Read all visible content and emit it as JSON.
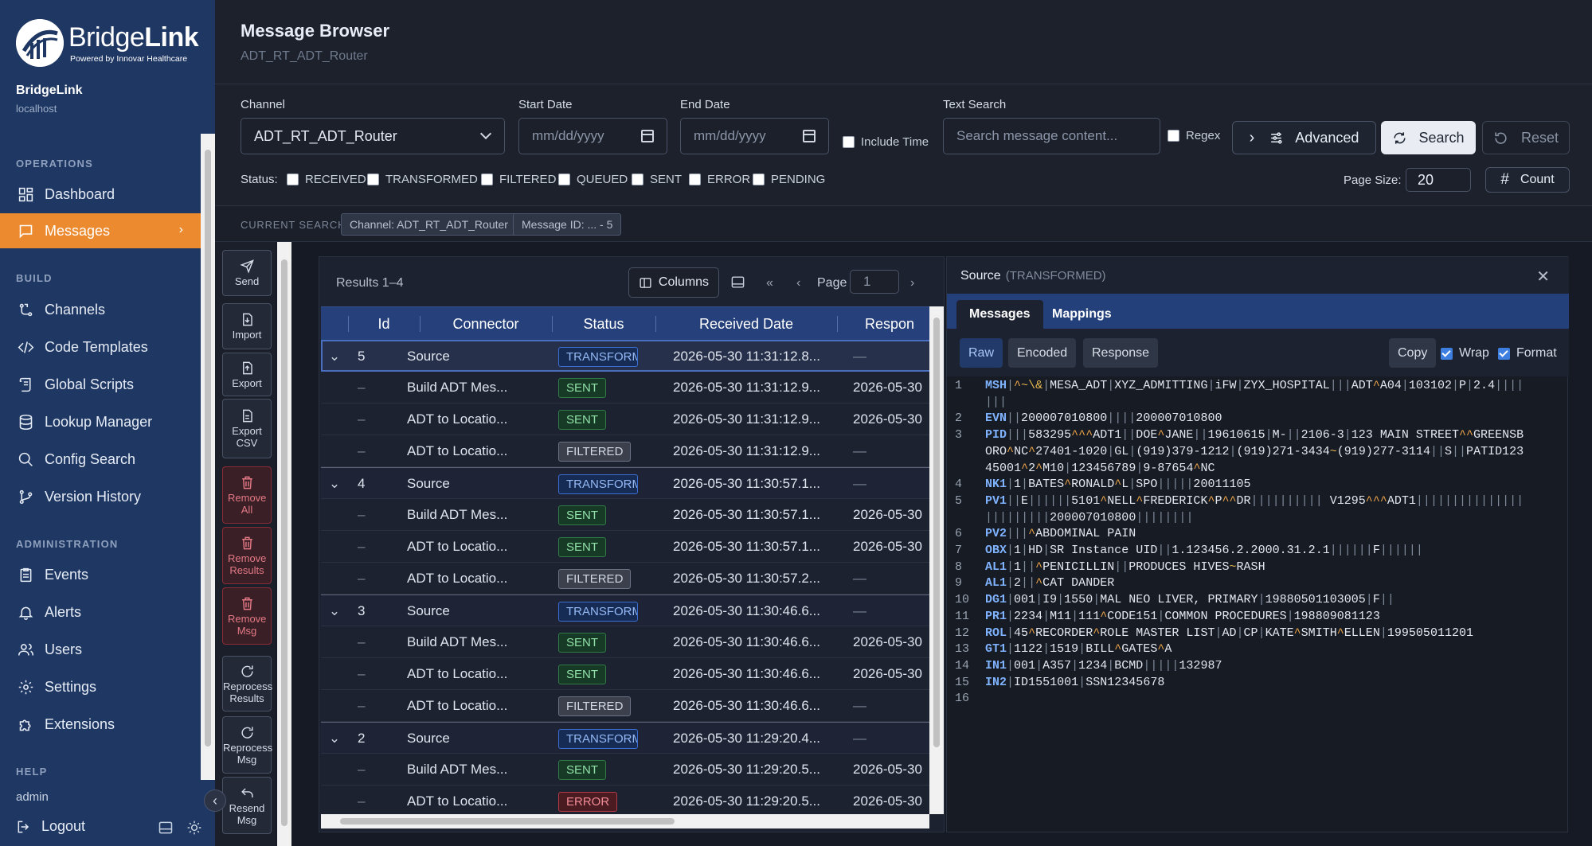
{
  "brand": {
    "name": "BridgeLink",
    "name_a": "Bridge",
    "name_b": "Link",
    "tagline": "Powered by Innovar Healthcare",
    "instance": "BridgeLink",
    "host": "localhost"
  },
  "colors": {
    "sidebar": "#1f3763",
    "accent": "#ec8a2f",
    "table_header": "#25407a",
    "sent": "#2f7a47",
    "error": "#b23a46",
    "transformed": "#3b6ed1"
  },
  "sidebar": {
    "sections": [
      {
        "label": "OPERATIONS",
        "items": [
          {
            "label": "Dashboard",
            "icon": "grid-icon"
          },
          {
            "label": "Messages",
            "icon": "message-icon",
            "active": true
          }
        ]
      },
      {
        "label": "BUILD",
        "items": [
          {
            "label": "Channels",
            "icon": "channels-icon"
          },
          {
            "label": "Code Templates",
            "icon": "code-icon"
          },
          {
            "label": "Global Scripts",
            "icon": "scroll-icon"
          },
          {
            "label": "Lookup Manager",
            "icon": "database-icon"
          },
          {
            "label": "Config Search",
            "icon": "search-icon"
          },
          {
            "label": "Version History",
            "icon": "git-icon"
          }
        ]
      },
      {
        "label": "ADMINISTRATION",
        "items": [
          {
            "label": "Events",
            "icon": "clipboard-icon"
          },
          {
            "label": "Alerts",
            "icon": "bell-icon"
          },
          {
            "label": "Users",
            "icon": "users-icon"
          },
          {
            "label": "Settings",
            "icon": "gear-icon"
          },
          {
            "label": "Extensions",
            "icon": "puzzle-icon"
          }
        ]
      },
      {
        "label": "HELP",
        "items": []
      }
    ],
    "user": "admin",
    "logout": "Logout"
  },
  "header": {
    "title": "Message Browser",
    "subtitle": "ADT_RT_ADT_Router"
  },
  "filters": {
    "channel_label": "Channel",
    "channel_value": "ADT_RT_ADT_Router",
    "start_label": "Start Date",
    "start_placeholder": "mm/dd/yyyy",
    "end_label": "End Date",
    "end_placeholder": "mm/dd/yyyy",
    "include_time": "Include Time",
    "text_label": "Text Search",
    "text_placeholder": "Search message content...",
    "regex": "Regex",
    "advanced": "Advanced",
    "search": "Search",
    "reset": "Reset",
    "status_label": "Status:",
    "statuses": [
      "RECEIVED",
      "TRANSFORMED",
      "FILTERED",
      "QUEUED",
      "SENT",
      "ERROR",
      "PENDING"
    ],
    "page_size_label": "Page Size:",
    "page_size": "20",
    "count": "Count"
  },
  "current_search": {
    "label": "CURRENT SEARCH",
    "chips": [
      "Channel: ADT_RT_ADT_Router",
      "Message ID: ... - 5"
    ]
  },
  "actions": [
    {
      "label": "Send",
      "icon": "send-icon"
    },
    {
      "label": "Import",
      "icon": "import-icon"
    },
    {
      "label": "Export",
      "icon": "export-icon"
    },
    {
      "label": "Export CSV",
      "icon": "csv-icon"
    },
    {
      "label": "Remove All",
      "icon": "trash-icon",
      "danger": true
    },
    {
      "label": "Remove Results",
      "icon": "trash-icon",
      "danger": true
    },
    {
      "label": "Remove Msg",
      "icon": "trash-icon",
      "danger": true
    },
    {
      "label": "Reprocess Results",
      "icon": "reprocess-icon"
    },
    {
      "label": "Reprocess Msg",
      "icon": "reprocess-icon"
    },
    {
      "label": "Resend Msg",
      "icon": "resend-icon"
    }
  ],
  "results": {
    "label": "Results 1–4",
    "columns_btn": "Columns",
    "page_label": "Page",
    "page": "1",
    "headers": [
      "Id",
      "Connector",
      "Status",
      "Received Date",
      "Respon"
    ],
    "rows": [
      {
        "id": "5",
        "connector": "Source",
        "status": "TRANSFORMED",
        "received": "2026-05-30 11:31:12.8...",
        "response": "—",
        "source": true
      },
      {
        "id": "–",
        "connector": "Build ADT Mes...",
        "status": "SENT",
        "received": "2026-05-30 11:31:12.9...",
        "response": "2026-05-30"
      },
      {
        "id": "–",
        "connector": "ADT to Locatio...",
        "status": "SENT",
        "received": "2026-05-30 11:31:12.9...",
        "response": "2026-05-30"
      },
      {
        "id": "–",
        "connector": "ADT to Locatio...",
        "status": "FILTERED",
        "received": "2026-05-30 11:31:12.9...",
        "response": "—"
      },
      {
        "id": "4",
        "connector": "Source",
        "status": "TRANSFORMED",
        "received": "2026-05-30 11:30:57.1...",
        "response": "—",
        "source": true
      },
      {
        "id": "–",
        "connector": "Build ADT Mes...",
        "status": "SENT",
        "received": "2026-05-30 11:30:57.1...",
        "response": "2026-05-30"
      },
      {
        "id": "–",
        "connector": "ADT to Locatio...",
        "status": "SENT",
        "received": "2026-05-30 11:30:57.1...",
        "response": "2026-05-30"
      },
      {
        "id": "–",
        "connector": "ADT to Locatio...",
        "status": "FILTERED",
        "received": "2026-05-30 11:30:57.2...",
        "response": "—"
      },
      {
        "id": "3",
        "connector": "Source",
        "status": "TRANSFORMED",
        "received": "2026-05-30 11:30:46.6...",
        "response": "—",
        "source": true
      },
      {
        "id": "–",
        "connector": "Build ADT Mes...",
        "status": "SENT",
        "received": "2026-05-30 11:30:46.6...",
        "response": "2026-05-30"
      },
      {
        "id": "–",
        "connector": "ADT to Locatio...",
        "status": "SENT",
        "received": "2026-05-30 11:30:46.6...",
        "response": "2026-05-30"
      },
      {
        "id": "–",
        "connector": "ADT to Locatio...",
        "status": "FILTERED",
        "received": "2026-05-30 11:30:46.6...",
        "response": "—"
      },
      {
        "id": "2",
        "connector": "Source",
        "status": "TRANSFORMED",
        "received": "2026-05-30 11:29:20.4...",
        "response": "—",
        "source": true
      },
      {
        "id": "–",
        "connector": "Build ADT Mes...",
        "status": "SENT",
        "received": "2026-05-30 11:29:20.5...",
        "response": "2026-05-30"
      },
      {
        "id": "–",
        "connector": "ADT to Locatio...",
        "status": "ERROR",
        "received": "2026-05-30 11:29:20.5...",
        "response": "2026-05-30"
      }
    ]
  },
  "viewer": {
    "title": "Source",
    "subtitle": "(TRANSFORMED)",
    "tabs": [
      "Messages",
      "Mappings"
    ],
    "modes": [
      "Raw",
      "Encoded",
      "Response"
    ],
    "copy": "Copy",
    "wrap": "Wrap",
    "format": "Format",
    "lines": [
      "MSH|^~\\&|MESA_ADT|XYZ_ADMITTING|iFW|ZYX_HOSPITAL|||ADT^A04|103102|P|2.4|||||||",
      "EVN||200007010800||||200007010800",
      "PID|||583295^^^ADT1||DOE^JANE||19610615|M-||2106-3|123 MAIN STREET^^GREENSBORO^NC^27401-1020|GL|(919)379-1212|(919)271-3434~(919)277-3114||S||PATID12345001^2^M10|123456789|9-87654^NC",
      "NK1|1|BATES^RONALD^L|SPO|||||20011105",
      "PV1||E||||||5101^NELL^FREDERICK^P^^DR|||||||||| V1295^^^ADT1||||||||||||||||||||||||200007010800||||||||",
      "PV2|||^ABDOMINAL PAIN",
      "OBX|1|HD|SR Instance UID||1.123456.2.2000.31.2.1||||||F||||||",
      "AL1|1||^PENICILLIN||PRODUCES HIVES~RASH",
      "AL1|2||^CAT DANDER",
      "DG1|001|I9|1550|MAL NEO LIVER, PRIMARY|19880501103005|F||",
      "PR1|2234|M11|111^CODE151|COMMON PROCEDURES|198809081123",
      "ROL|45^RECORDER^ROLE MASTER LIST|AD|CP|KATE^SMITH^ELLEN|199505011201",
      "GT1|1122|1519|BILL^GATES^A",
      "IN1|001|A357|1234|BCMD|||||132987",
      "IN2|ID1551001|SSN12345678",
      ""
    ]
  }
}
